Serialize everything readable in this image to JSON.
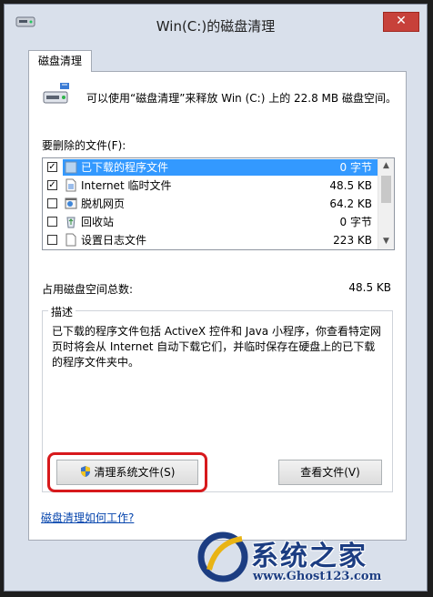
{
  "window": {
    "title": "Win(C:)的磁盘清理",
    "close_label": "✕"
  },
  "tab": {
    "label": "磁盘清理"
  },
  "intro": "可以使用“磁盘清理”来释放 Win (C:) 上的 22.8 MB 磁盘空间。",
  "files_label": "要删除的文件(F):",
  "files": [
    {
      "name": "已下载的程序文件",
      "size": "0 字节",
      "checked": true,
      "selected": true,
      "icon": "folder-icon"
    },
    {
      "name": "Internet 临时文件",
      "size": "48.5 KB",
      "checked": true,
      "selected": false,
      "icon": "document-icon"
    },
    {
      "name": "脱机网页",
      "size": "64.2 KB",
      "checked": false,
      "selected": false,
      "icon": "webpage-icon"
    },
    {
      "name": "回收站",
      "size": "0 字节",
      "checked": false,
      "selected": false,
      "icon": "recycle-bin-icon"
    },
    {
      "name": "设置日志文件",
      "size": "223 KB",
      "checked": false,
      "selected": false,
      "icon": "blank-file-icon"
    }
  ],
  "total": {
    "label": "占用磁盘空间总数:",
    "value": "48.5 KB"
  },
  "description": {
    "title": "描述",
    "text": "已下载的程序文件包括 ActiveX 控件和 Java 小程序，你查看特定网页时将会从 Internet 自动下载它们，并临时保存在硬盘上的已下载的程序文件夹中。"
  },
  "buttons": {
    "clean_system": "清理系统文件(S)",
    "view_files": "查看文件(V)"
  },
  "help_link": "磁盘清理如何工作?",
  "watermark": {
    "cn": "系统之家",
    "url": "www.Ghost123.com"
  },
  "colors": {
    "selection": "#3399ff",
    "highlight": "#d7191c",
    "close": "#c7413a"
  }
}
